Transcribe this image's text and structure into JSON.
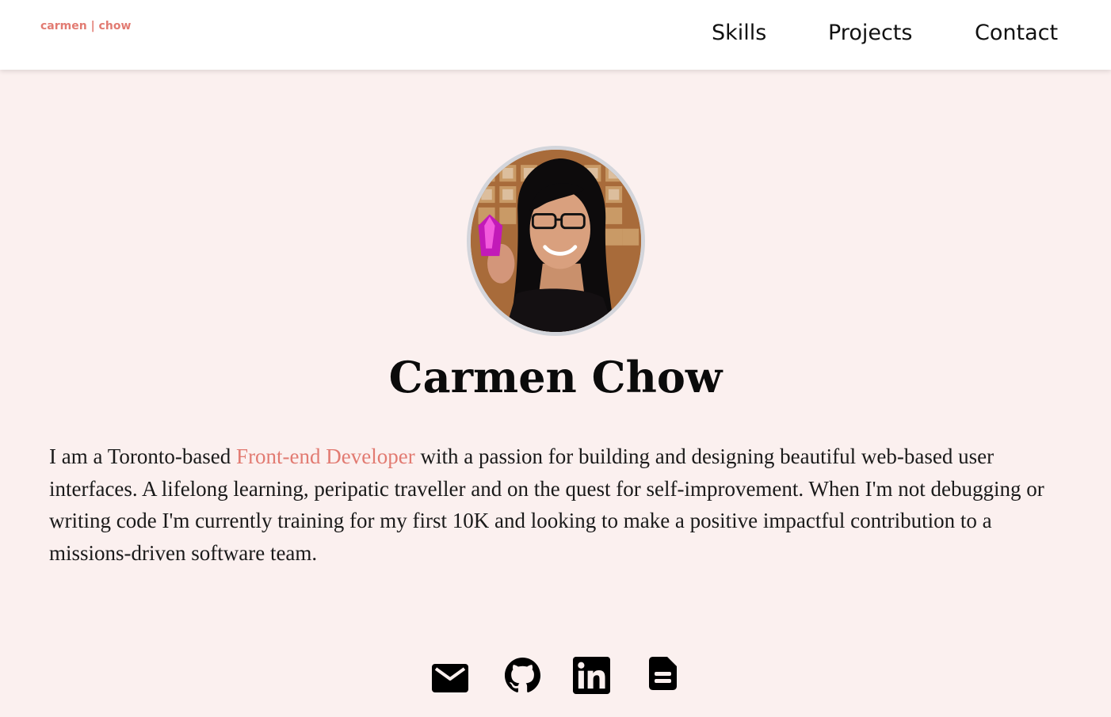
{
  "header": {
    "logo": "carmen | chow",
    "nav": {
      "skills": "Skills",
      "projects": "Projects",
      "contact": "Contact"
    }
  },
  "hero": {
    "name": "Carmen Chow",
    "bio_intro": "I am a Toronto-based ",
    "bio_role": "Front-end Developer",
    "bio_rest": " with a passion for building and designing beautiful web-based user interfaces. A lifelong learning, peripatic traveller and on the quest for self-improvement. When I'm not debugging or writing code I'm currently training for my first 10K and looking to make a positive impactful contribution to a missions-driven software team."
  },
  "social": [
    {
      "icon": "mail-icon"
    },
    {
      "icon": "github-icon"
    },
    {
      "icon": "linkedin-icon"
    },
    {
      "icon": "resume-icon"
    }
  ],
  "colors": {
    "accent": "#e27b72",
    "background": "#fbf0ef",
    "header_bg": "#ffffff",
    "text": "#111111",
    "avatar_border": "#d3d5db"
  }
}
